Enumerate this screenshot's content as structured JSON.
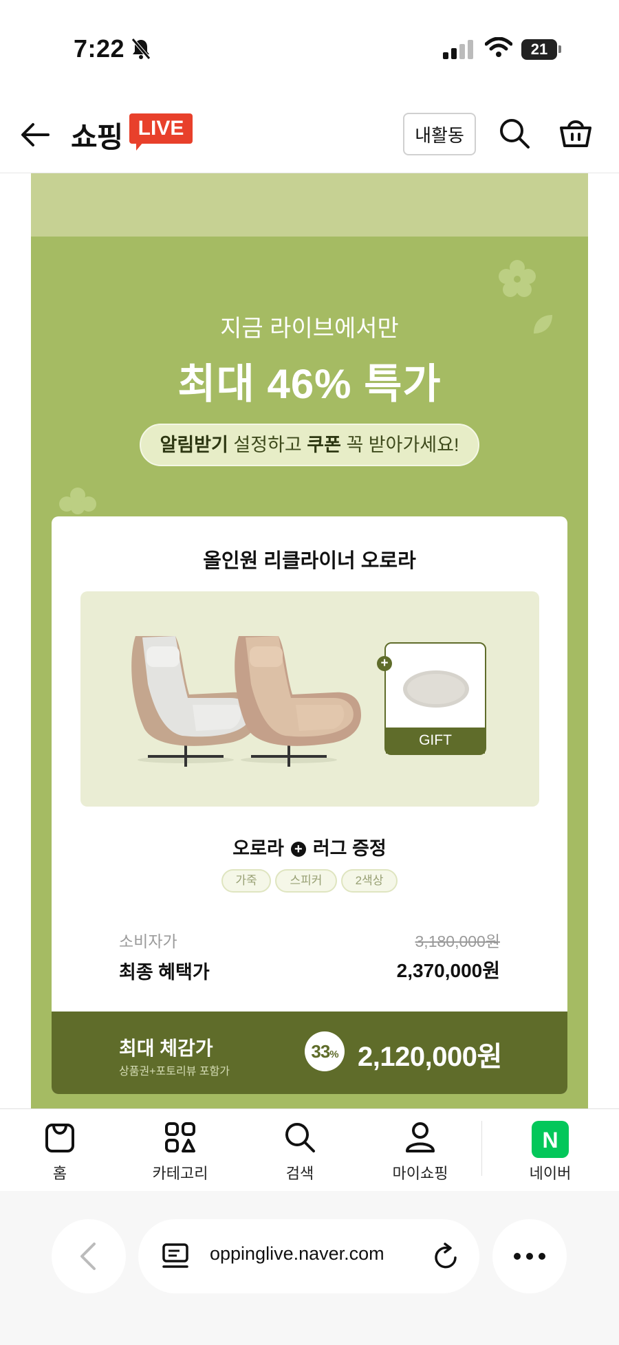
{
  "status_bar": {
    "time": "7:22",
    "battery": "21"
  },
  "header": {
    "logo_text": "쇼핑",
    "logo_badge": "LIVE",
    "my_activity_label": "내활동"
  },
  "promo": {
    "subtitle": "지금 라이브에서만",
    "title": "최대 46% 특가",
    "coupon_bold1": "알림받기",
    "coupon_text1": " 설정하고 ",
    "coupon_bold2": "쿠폰",
    "coupon_text2": " 꼭 받아가세요!"
  },
  "product": {
    "name": "올인원 리클라이너 오로라",
    "gift_label": "GIFT",
    "bundle_left": "오로라",
    "bundle_right": "러그 증정",
    "tags": [
      "가죽",
      "스피커",
      "2색상"
    ],
    "consumer_price_label": "소비자가",
    "consumer_price": "3,180,000원",
    "final_price_label": "최종 혜택가",
    "final_price": "2,370,000원",
    "max_price_label": "최대 체감가",
    "max_price_note": "상품권+포토리뷰 포함가",
    "discount_pct": "33",
    "discount_unit": "%",
    "max_price": "2,120,000원"
  },
  "bottom_nav": {
    "items": [
      {
        "label": "홈",
        "icon": "bag-icon"
      },
      {
        "label": "카테고리",
        "icon": "category-icon"
      },
      {
        "label": "검색",
        "icon": "search-icon"
      },
      {
        "label": "마이쇼핑",
        "icon": "person-icon"
      },
      {
        "label": "네이버",
        "icon": "naver-icon"
      }
    ]
  },
  "browser": {
    "url": "oppinglive.naver.com"
  },
  "colors": {
    "olive_dark": "#5f6c2a",
    "green_bg": "#a5bb63",
    "live_red": "#e8402b",
    "naver_green": "#03c75a"
  }
}
